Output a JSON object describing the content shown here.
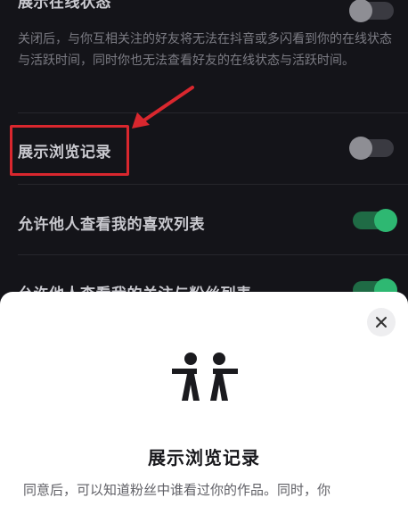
{
  "settings": {
    "online_status": {
      "title": "展示在线状态",
      "desc": "关闭后，与你互相关注的好友将无法在抖音或多闪看到你的在线状态与活跃时间，同时你也无法查看好友的在线状态与活跃时间。",
      "enabled": false
    },
    "browse_history": {
      "title": "展示浏览记录",
      "enabled": false
    },
    "likes_list": {
      "title": "允许他人查看我的喜欢列表",
      "enabled": true
    },
    "follow_fans_list": {
      "title": "允许他人查看我的关注与粉丝列表",
      "enabled": true
    }
  },
  "sheet": {
    "icon": "two-people-icon",
    "title": "展示浏览记录",
    "body": "同意后，可以知道粉丝中谁看过你的作品。同时，你"
  },
  "colors": {
    "background": "#141419",
    "toggle_on": "#2eb872",
    "annotation_red": "#d9272e"
  }
}
